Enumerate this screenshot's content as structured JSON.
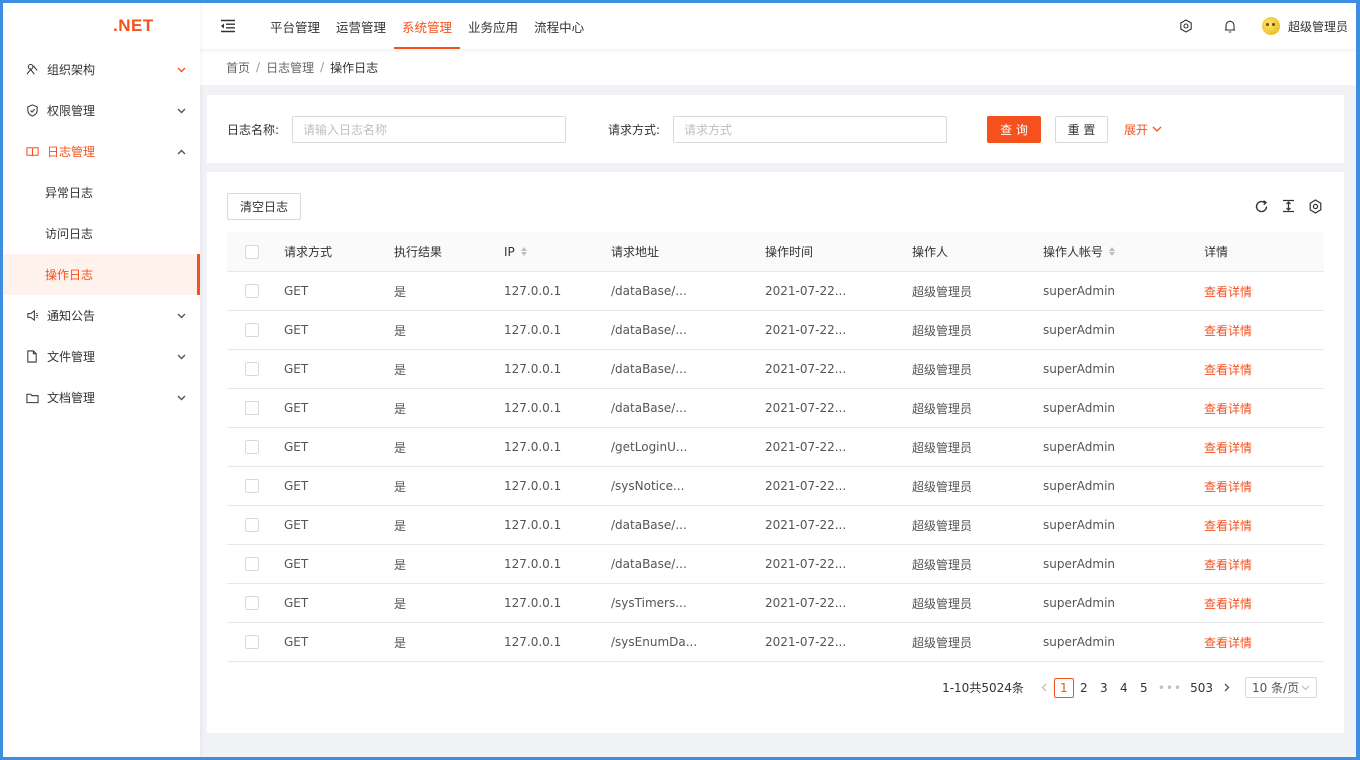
{
  "app": {
    "logo_text": ".NET"
  },
  "colors": {
    "accent": "#f4511e",
    "frame": "#3d8ee0"
  },
  "sidebar": {
    "items": [
      {
        "label": "组织架构",
        "icon": "org-icon",
        "open": false
      },
      {
        "label": "权限管理",
        "icon": "shield-icon",
        "open": false
      },
      {
        "label": "日志管理",
        "icon": "book-icon",
        "open": true,
        "children": [
          {
            "label": "异常日志",
            "active": false
          },
          {
            "label": "访问日志",
            "active": false
          },
          {
            "label": "操作日志",
            "active": true
          }
        ]
      },
      {
        "label": "通知公告",
        "icon": "speaker-icon",
        "open": false
      },
      {
        "label": "文件管理",
        "icon": "file-icon",
        "open": false
      },
      {
        "label": "文档管理",
        "icon": "folder-icon",
        "open": false
      }
    ]
  },
  "header": {
    "nav": [
      {
        "label": "平台管理",
        "active": false
      },
      {
        "label": "运营管理",
        "active": false
      },
      {
        "label": "系统管理",
        "active": true
      },
      {
        "label": "业务应用",
        "active": false
      },
      {
        "label": "流程中心",
        "active": false
      }
    ],
    "user_name": "超级管理员"
  },
  "breadcrumb": [
    "首页",
    "日志管理",
    "操作日志"
  ],
  "search": {
    "name_label": "日志名称:",
    "name_placeholder": "请输入日志名称",
    "method_label": "请求方式:",
    "method_placeholder": "请求方式",
    "query_button": "查 询",
    "reset_button": "重 置",
    "expand_link": "展开"
  },
  "table": {
    "clear_button": "清空日志",
    "columns": [
      "请求方式",
      "执行结果",
      "IP",
      "请求地址",
      "操作时间",
      "操作人",
      "操作人帐号",
      "详情"
    ],
    "rows": [
      [
        "GET",
        "是",
        "127.0.0.1",
        "/dataBase/...",
        "2021-07-22...",
        "超级管理员",
        "superAdmin",
        "查看详情"
      ],
      [
        "GET",
        "是",
        "127.0.0.1",
        "/dataBase/...",
        "2021-07-22...",
        "超级管理员",
        "superAdmin",
        "查看详情"
      ],
      [
        "GET",
        "是",
        "127.0.0.1",
        "/dataBase/...",
        "2021-07-22...",
        "超级管理员",
        "superAdmin",
        "查看详情"
      ],
      [
        "GET",
        "是",
        "127.0.0.1",
        "/dataBase/...",
        "2021-07-22...",
        "超级管理员",
        "superAdmin",
        "查看详情"
      ],
      [
        "GET",
        "是",
        "127.0.0.1",
        "/getLoginU...",
        "2021-07-22...",
        "超级管理员",
        "superAdmin",
        "查看详情"
      ],
      [
        "GET",
        "是",
        "127.0.0.1",
        "/sysNotice...",
        "2021-07-22...",
        "超级管理员",
        "superAdmin",
        "查看详情"
      ],
      [
        "GET",
        "是",
        "127.0.0.1",
        "/dataBase/...",
        "2021-07-22...",
        "超级管理员",
        "superAdmin",
        "查看详情"
      ],
      [
        "GET",
        "是",
        "127.0.0.1",
        "/dataBase/...",
        "2021-07-22...",
        "超级管理员",
        "superAdmin",
        "查看详情"
      ],
      [
        "GET",
        "是",
        "127.0.0.1",
        "/sysTimers...",
        "2021-07-22...",
        "超级管理员",
        "superAdmin",
        "查看详情"
      ],
      [
        "GET",
        "是",
        "127.0.0.1",
        "/sysEnumDa...",
        "2021-07-22...",
        "超级管理员",
        "superAdmin",
        "查看详情"
      ]
    ]
  },
  "pagination": {
    "total_text": "1-10共5024条",
    "pages": [
      "1",
      "2",
      "3",
      "4",
      "5"
    ],
    "current": "1",
    "ellipsis": "•••",
    "last_page": "503",
    "page_size": "10 条/页"
  }
}
